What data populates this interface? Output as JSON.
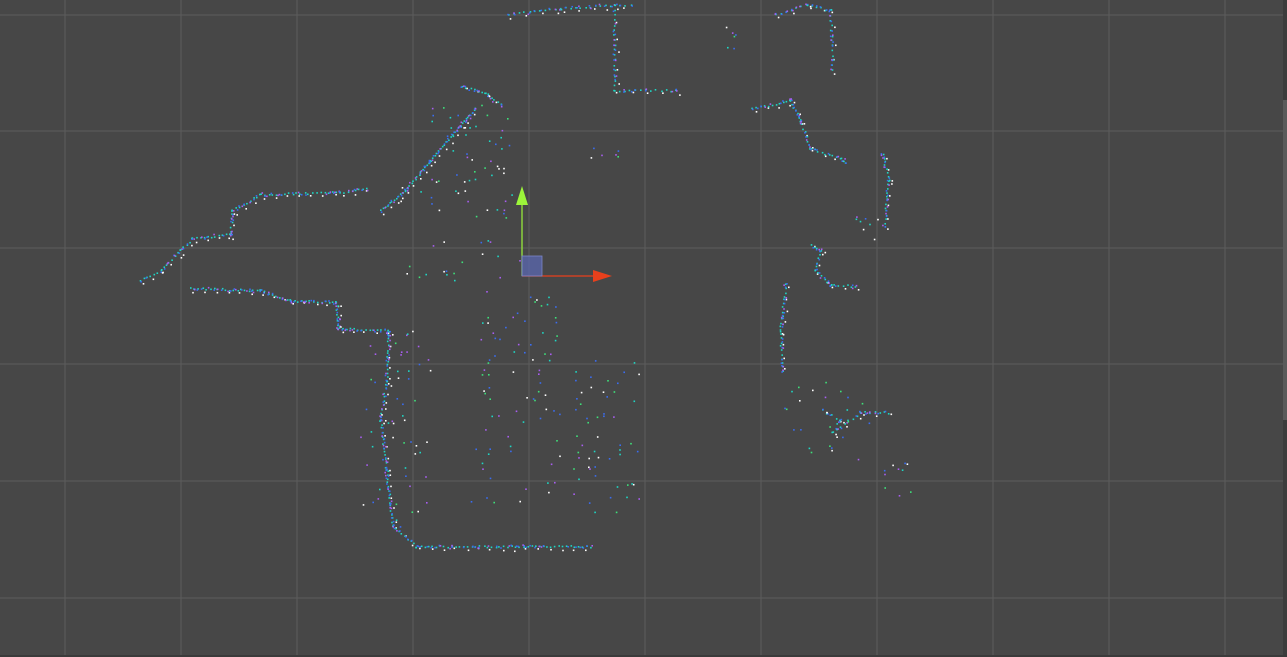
{
  "viewport": {
    "background": "#474747",
    "grid_color": "#5c5c5c",
    "grid_on": true
  },
  "axes_gizmo": {
    "x_axis_color": "#e8401c",
    "y_axis_color": "#9cf53a",
    "origin_color": "#5a67b0",
    "icons": [
      "x-axis-arrow-icon",
      "y-axis-arrow-icon",
      "origin-box-icon"
    ]
  },
  "point_cloud": {
    "point_colors": [
      "#ffffff",
      "#1fd6c4",
      "#3a6df0",
      "#a85ef0",
      "#3ee07a"
    ],
    "description_hidden": ""
  },
  "scrollbar": {
    "track_color": "#3c3c3c",
    "thumb_color": "#5a5a5a"
  }
}
